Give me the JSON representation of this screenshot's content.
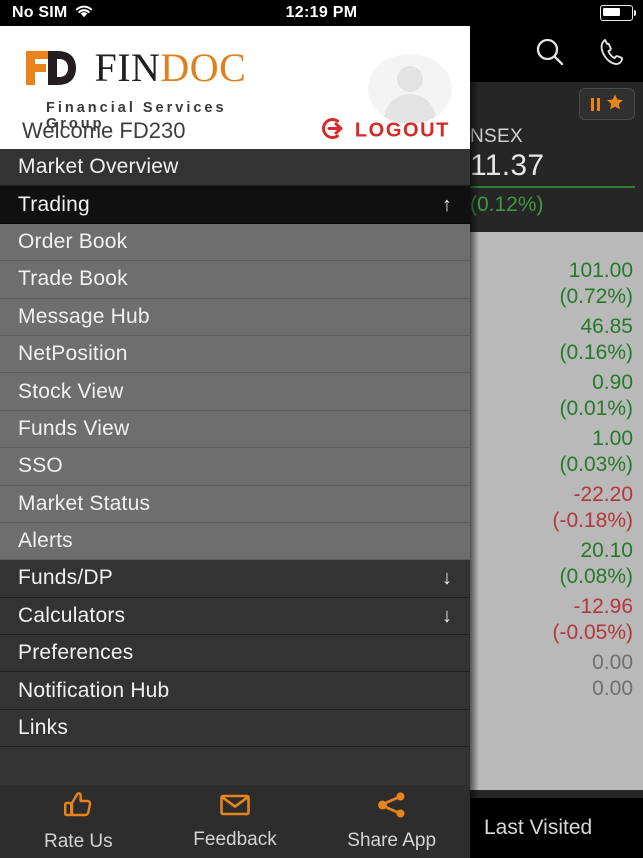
{
  "status_bar": {
    "carrier": "No SIM",
    "wifi_icon": "wifi-icon",
    "time": "12:19 PM",
    "battery_icon": "battery-icon"
  },
  "background_app": {
    "nav_icons": [
      {
        "name": "search-icon",
        "label": "Search"
      },
      {
        "name": "phone-icon",
        "label": "Call"
      }
    ],
    "favorite_button": {
      "pause_icon": "pause-icon",
      "star_icon": "star-icon"
    },
    "index": {
      "name": "NSEX",
      "value": "11.37",
      "change_percent": "(0.12%)",
      "direction": "up"
    },
    "watchlist_rows": [
      {
        "change": "101.00",
        "percent": "(0.72%)",
        "direction": "up"
      },
      {
        "change": "46.85",
        "percent": "(0.16%)",
        "direction": "up"
      },
      {
        "change": "0.90",
        "percent": "(0.01%)",
        "direction": "up"
      },
      {
        "change": "1.00",
        "percent": "(0.03%)",
        "direction": "up"
      },
      {
        "change": "-22.20",
        "percent": "(-0.18%)",
        "direction": "down"
      },
      {
        "change": "20.10",
        "percent": "(0.08%)",
        "direction": "up"
      },
      {
        "change": "-12.96",
        "percent": "(-0.05%)",
        "direction": "down"
      },
      {
        "change": "0.00",
        "percent": "0.00",
        "direction": "flat"
      }
    ],
    "last_visited_label": "Last Visited"
  },
  "drawer": {
    "logo": {
      "mark": "fd-monogram-icon",
      "word_first": "FIN",
      "word_second": "DOC",
      "subtitle": "Financial Services Group"
    },
    "avatar": "user-avatar-icon",
    "welcome_text": "Welcome FD230",
    "logout": {
      "label": "LOGOUT",
      "icon": "logout-icon"
    },
    "menu_items": [
      {
        "label": "Market Overview",
        "level": "top",
        "state": "none",
        "arrow": ""
      },
      {
        "label": "Trading",
        "level": "top",
        "state": "open",
        "arrow": "↑"
      },
      {
        "label": "Order Book",
        "level": "sub",
        "state": "none",
        "arrow": ""
      },
      {
        "label": "Trade Book",
        "level": "sub",
        "state": "none",
        "arrow": ""
      },
      {
        "label": "Message Hub",
        "level": "sub",
        "state": "none",
        "arrow": ""
      },
      {
        "label": "NetPosition",
        "level": "sub",
        "state": "none",
        "arrow": ""
      },
      {
        "label": "Stock View",
        "level": "sub",
        "state": "none",
        "arrow": ""
      },
      {
        "label": "Funds View",
        "level": "sub",
        "state": "none",
        "arrow": ""
      },
      {
        "label": "SSO",
        "level": "sub",
        "state": "none",
        "arrow": ""
      },
      {
        "label": "Market Status",
        "level": "sub",
        "state": "none",
        "arrow": ""
      },
      {
        "label": "Alerts",
        "level": "sub",
        "state": "none",
        "arrow": ""
      },
      {
        "label": "Funds/DP",
        "level": "top",
        "state": "closed",
        "arrow": "↓"
      },
      {
        "label": "Calculators",
        "level": "top",
        "state": "closed",
        "arrow": "↓"
      },
      {
        "label": "Preferences",
        "level": "top",
        "state": "none",
        "arrow": ""
      },
      {
        "label": "Notification Hub",
        "level": "top",
        "state": "none",
        "arrow": ""
      },
      {
        "label": "Links",
        "level": "top",
        "state": "none",
        "arrow": ""
      }
    ]
  },
  "tab_bar": [
    {
      "label": "Rate Us",
      "icon": "thumbs-up-icon"
    },
    {
      "label": "Feedback",
      "icon": "envelope-icon"
    },
    {
      "label": "Share App",
      "icon": "share-icon"
    }
  ],
  "colors": {
    "accent_orange": "#e8841a",
    "up_green": "#257a2a",
    "down_red": "#b3373c",
    "logout_red": "#d42b28",
    "drawer_bg": "#333333",
    "submenu_bg": "#6e6e6e"
  }
}
